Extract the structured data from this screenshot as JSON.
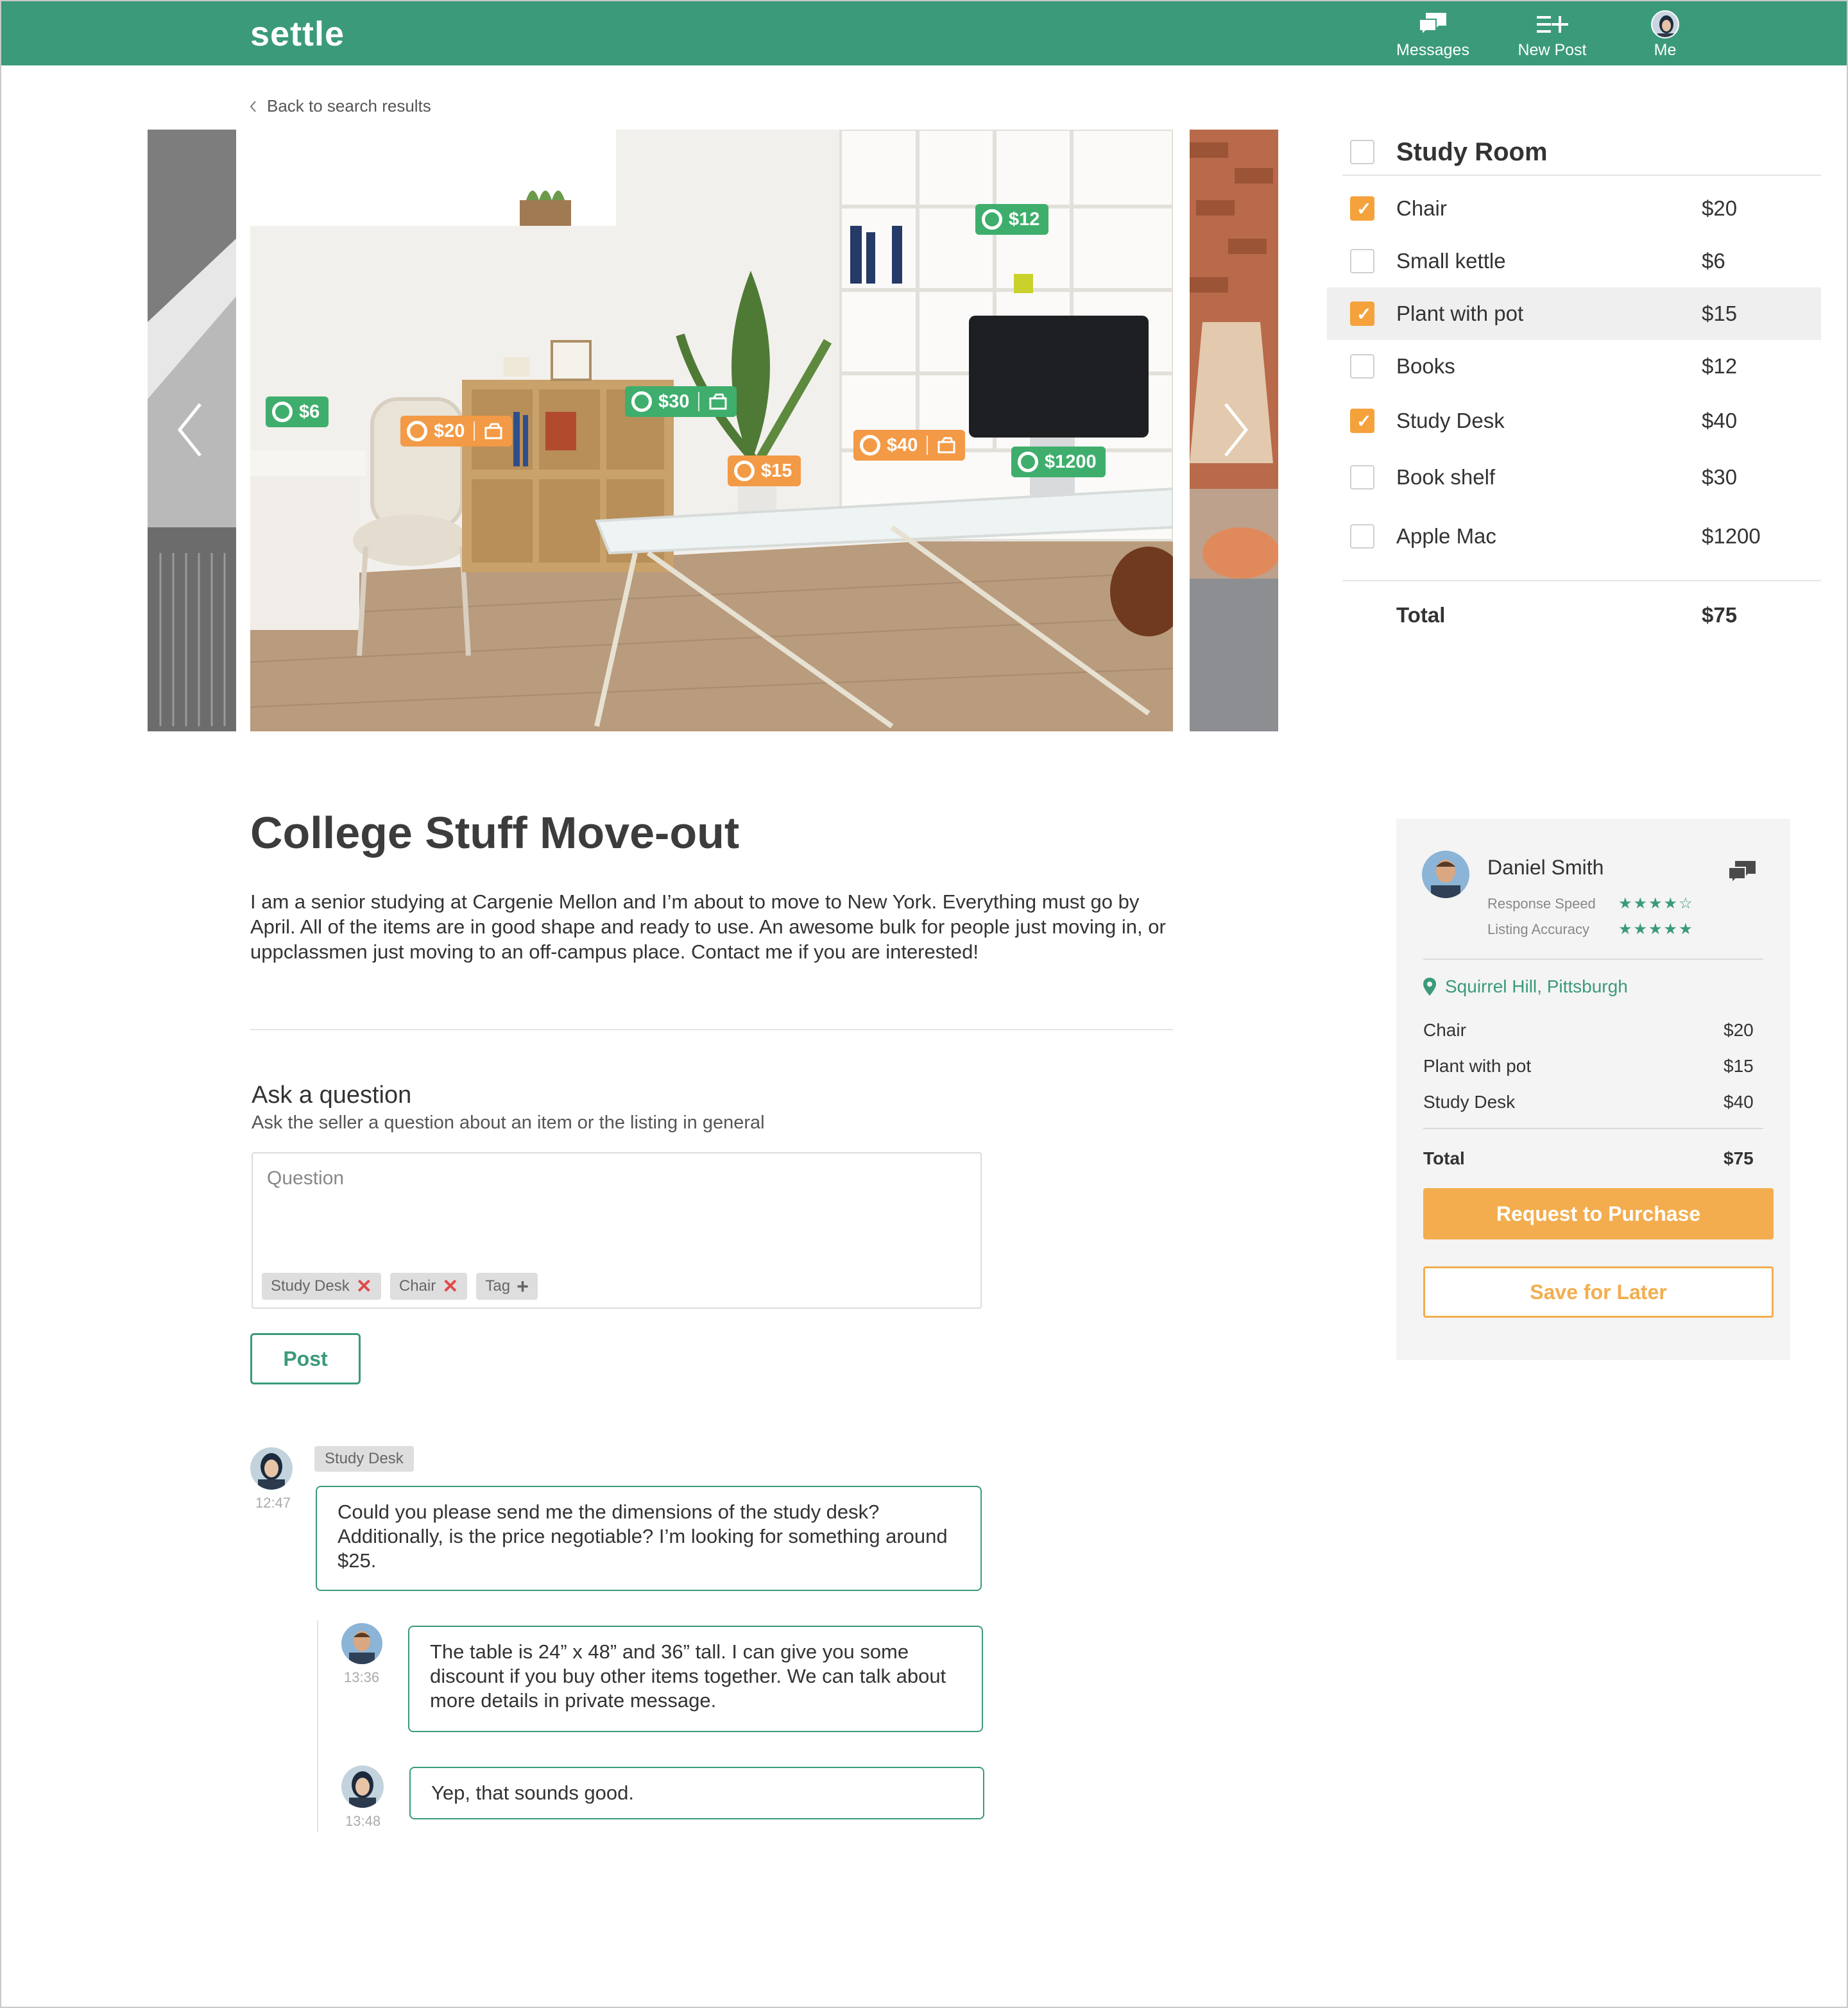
{
  "header": {
    "logo": "settle",
    "nav": [
      {
        "label": "Messages",
        "icon": "messages-icon"
      },
      {
        "label": "New Post",
        "icon": "new-post-icon"
      },
      {
        "label": "Me",
        "icon": "avatar"
      }
    ],
    "color": "#3a9a79"
  },
  "back_link": "Back to search results",
  "photo_tags": [
    {
      "price": "$6",
      "color": "green"
    },
    {
      "price": "$20",
      "color": "orange"
    },
    {
      "price": "$30",
      "color": "green"
    },
    {
      "price": "$15",
      "color": "orange"
    },
    {
      "price": "$40",
      "color": "orange"
    },
    {
      "price": "$12",
      "color": "green"
    },
    {
      "price": "$1200",
      "color": "green"
    }
  ],
  "checklist": {
    "title": "Study Room",
    "items": [
      {
        "name": "Chair",
        "price": "$20",
        "checked": true
      },
      {
        "name": "Small kettle",
        "price": "$6",
        "checked": false
      },
      {
        "name": "Plant with pot",
        "price": "$15",
        "checked": true
      },
      {
        "name": "Books",
        "price": "$12",
        "checked": false
      },
      {
        "name": "Study Desk",
        "price": "$40",
        "checked": true
      },
      {
        "name": "Book shelf",
        "price": "$30",
        "checked": false
      },
      {
        "name": "Apple Mac",
        "price": "$1200",
        "checked": false
      }
    ],
    "total_label": "Total",
    "total_value": "$75"
  },
  "listing": {
    "title": "College Stuff Move-out",
    "description": "I am a senior studying at Cargenie Mellon and I’m about to move to New York. Everything must go by April. All of the items are in good shape and ready to use. An awesome bulk for people just moving in, or uppclassmen just moving to an off-campus place. Contact me if you are interested!"
  },
  "ask": {
    "title": "Ask a question",
    "subtitle": "Ask the seller a question about an item or the listing in general",
    "placeholder": "Question",
    "chips": [
      "Study Desk",
      "Chair"
    ],
    "add_tag": "Tag",
    "post_label": "Post"
  },
  "comments": {
    "question_tag": "Study Desk",
    "question": {
      "time": "12:47",
      "text": "Could you please send me the dimensions of the study desk? Additionally, is the price negotiable? I’m looking for something around $25."
    },
    "replies": [
      {
        "time": "13:36",
        "text": "The table is 24” x 48” and 36” tall. I can give you some discount if you buy other items together. We can talk about more details in private message."
      },
      {
        "time": "13:48",
        "text": "Yep, that sounds good."
      }
    ]
  },
  "seller": {
    "name": "Daniel Smith",
    "response_speed_label": "Response Speed",
    "response_speed_stars": 4,
    "listing_accuracy_label": "Listing Accuracy",
    "listing_accuracy_stars": 5,
    "location": "Squirrel Hill, Pittsburgh",
    "items": [
      {
        "name": "Chair",
        "price": "$20"
      },
      {
        "name": "Plant with pot",
        "price": "$15"
      },
      {
        "name": "Study Desk",
        "price": "$40"
      }
    ],
    "total_label": "Total",
    "total_value": "$75",
    "buy_label": "Request to Purchase",
    "save_label": "Save for Later"
  },
  "colors": {
    "accent": "#3a9a79",
    "orange": "#f3ad4f",
    "tag_green": "#3fae6d",
    "tag_orange": "#f39a46"
  }
}
